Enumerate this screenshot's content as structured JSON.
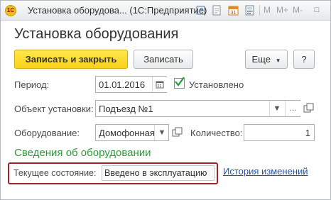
{
  "window": {
    "title": "Установка оборудова... (1С:Предприятие)",
    "logo_text": "1С",
    "m_buttons": [
      "M",
      "M+",
      "M-"
    ],
    "minimize": "–",
    "maximize": "□",
    "close": "×"
  },
  "form": {
    "title": "Установка оборудования",
    "toolbar": {
      "save_close": "Записать и закрыть",
      "save": "Записать",
      "more": "Еще",
      "help": "?"
    },
    "period": {
      "label": "Период:",
      "value": "01.01.2016"
    },
    "installed": {
      "label": "Установлено",
      "checked": true
    },
    "object": {
      "label": "Объект установки:",
      "value": "Подъезд №1"
    },
    "equipment": {
      "label": "Оборудование:",
      "value": "Домофонная"
    },
    "quantity": {
      "label": "Количество:",
      "value": "1"
    },
    "section_title": "Сведения об оборудовании",
    "state": {
      "label": "Текущее состояние:",
      "value": "Введено в эксплуатацию"
    },
    "history_link": "История изменений"
  },
  "colors": {
    "accent_yellow": "#f9d21a",
    "section_green": "#2e9a3a",
    "highlight_red": "#a3222a",
    "link_blue": "#2452a8"
  }
}
